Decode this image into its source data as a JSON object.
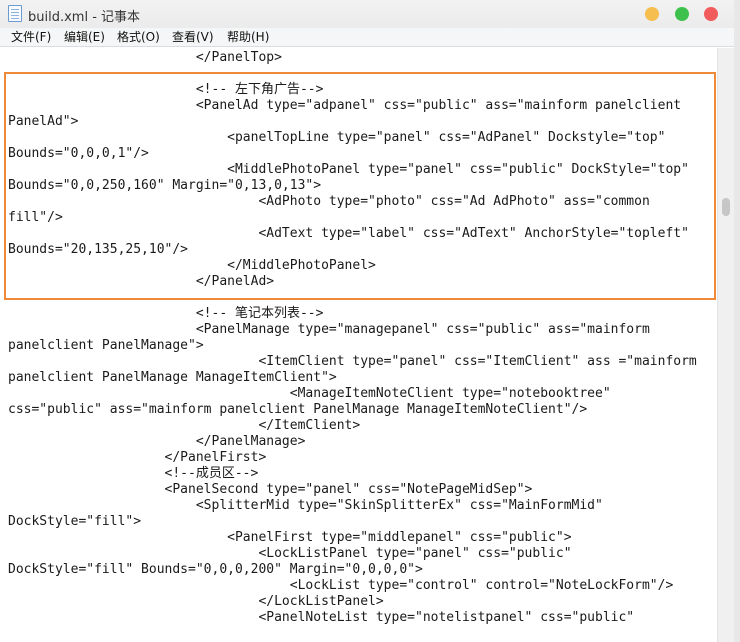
{
  "window": {
    "title": "build.xml - 记事本"
  },
  "menu": {
    "items": [
      "文件(F)",
      "编辑(E)",
      "格式(O)",
      "查看(V)",
      "帮助(H)"
    ]
  },
  "editor": {
    "lines": [
      "                        </PanelTop>",
      "",
      "                        <!-- 左下角广告-->",
      "                        <PanelAd type=\"adpanel\" css=\"public\" ass=\"mainform panelclient",
      "PanelAd\">",
      "                            <panelTopLine type=\"panel\" css=\"AdPanel\" Dockstyle=\"top\"",
      "Bounds=\"0,0,0,1\"/>",
      "                            <MiddlePhotoPanel type=\"panel\" css=\"public\" DockStyle=\"top\"",
      "Bounds=\"0,0,250,160\" Margin=\"0,13,0,13\">",
      "                                <AdPhoto type=\"photo\" css=\"Ad AdPhoto\" ass=\"common",
      "fill\"/>",
      "                                <AdText type=\"label\" css=\"AdText\" AnchorStyle=\"topleft\"",
      "Bounds=\"20,135,25,10\"/>",
      "                            </MiddlePhotoPanel>",
      "                        </PanelAd>",
      "",
      "                        <!-- 笔记本列表-->",
      "                        <PanelManage type=\"managepanel\" css=\"public\" ass=\"mainform",
      "panelclient PanelManage\">",
      "                                <ItemClient type=\"panel\" css=\"ItemClient\" ass =\"mainform",
      "panelclient PanelManage ManageItemClient\">",
      "                                    <ManageItemNoteClient type=\"notebooktree\"",
      "css=\"public\" ass=\"mainform panelclient PanelManage ManageItemNoteClient\"/>",
      "                                </ItemClient>",
      "                        </PanelManage>",
      "                    </PanelFirst>",
      "                    <!--成员区-->",
      "                    <PanelSecond type=\"panel\" css=\"NotePageMidSep\">",
      "                        <SplitterMid type=\"SkinSplitterEx\" css=\"MainFormMid\"",
      "DockStyle=\"fill\">",
      "                            <PanelFirst type=\"middlepanel\" css=\"public\">",
      "                                <LockListPanel type=\"panel\" css=\"public\"",
      "DockStyle=\"fill\" Bounds=\"0,0,0,200\" Margin=\"0,0,0,0\">",
      "                                    <LockList type=\"control\" control=\"NoteLockForm\"/>",
      "                                </LockListPanel>",
      "                                <PanelNoteList type=\"notelistpanel\" css=\"public\""
    ]
  },
  "colors": {
    "highlight_border": "#ee8a3a",
    "btn_min": "#f6be4f",
    "btn_max": "#3ec14c",
    "btn_close": "#f15b5b"
  },
  "icons": [
    "notepad-app-icon",
    "minimize-button",
    "maximize-button",
    "close-button"
  ]
}
